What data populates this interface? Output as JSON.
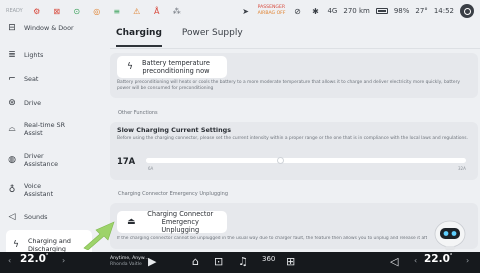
{
  "status_bar": {
    "edge_label": "READY",
    "passenger_airbag_line1": "PASSENGER",
    "passenger_airbag_line2": "AIRBAG OFF",
    "signal": "4G",
    "range": "270 km",
    "battery_percent": "98%",
    "outside_temp": "27°",
    "time": "14:52"
  },
  "sidebar": {
    "items": [
      {
        "label": "Window & Door",
        "icon": "door-icon"
      },
      {
        "label": "Lights",
        "icon": "headlight-icon"
      },
      {
        "label": "Seat",
        "icon": "seat-icon"
      },
      {
        "label": "Drive",
        "icon": "steering-wheel-icon"
      },
      {
        "label": "Real-time SR Assist",
        "icon": "car-radar-icon"
      },
      {
        "label": "Driver Assistance",
        "icon": "driver-assistance-icon"
      },
      {
        "label": "Voice Assistant",
        "icon": "voice-icon"
      },
      {
        "label": "Sounds",
        "icon": "speaker-icon"
      },
      {
        "label": "Charging and Discharging",
        "icon": "charging-icon"
      }
    ]
  },
  "tabs": [
    {
      "label": "Charging",
      "active": true
    },
    {
      "label": "Power Supply",
      "active": false
    }
  ],
  "battery_preconditioning": {
    "button_label": "Battery temperature preconditioning now",
    "description": "Battery preconditioning will heats or cools the battery to a more moderate temperature that allows it to charge and deliver electricity more quickly, battery power will be consumed for preconditioning"
  },
  "other_functions": {
    "section_label": "Other Functions",
    "slow_charging": {
      "title": "Slow Charging Current Settings",
      "description": "Before using the charging connector, please set the current intensity within a proper range or the one that is in compliance with the local laws and regulations.",
      "value": "17A",
      "min_label": "6A",
      "max_label": "32A",
      "level_fraction": 0.42
    }
  },
  "emergency_unplugging": {
    "section_label": "Charging Connector Emergency Unplugging",
    "button_label": "Charging Connector Emergency Unplugging",
    "description": "If the charging connector cannot be unplugged in the usual way due to charger fault, the feature then allows you to unplug and release it after"
  },
  "dock": {
    "left_temp": "22.0",
    "right_temp": "22.0",
    "temp_unit": "°",
    "track_title": "Anytime, Anyw...",
    "track_artist": "Rhonda Vaitle",
    "icons": [
      "play-icon",
      "home-icon",
      "car-icon",
      "music-icon",
      "360-view-icon",
      "apps-grid-icon",
      "volume-icon"
    ],
    "view_label": "360"
  },
  "colors": {
    "background": "#eef0f3",
    "card": "#e6e8ec",
    "dock": "#16191d",
    "arrow": "#9dd36a",
    "alert_red": "#d8483b"
  }
}
